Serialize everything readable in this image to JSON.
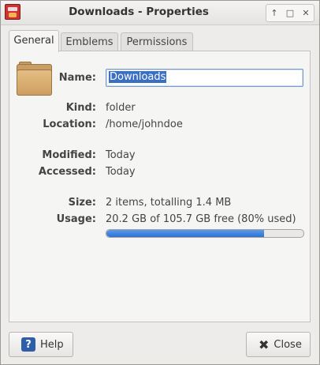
{
  "window": {
    "title": "Downloads - Properties",
    "buttons": {
      "up": "↑",
      "maximize": "□",
      "close": "✕"
    }
  },
  "tabs": [
    "General",
    "Emblems",
    "Permissions"
  ],
  "general": {
    "name_label": "Name:",
    "name_value": "Downloads",
    "kind_label": "Kind:",
    "kind_value": "folder",
    "location_label": "Location:",
    "location_value": "/home/johndoe",
    "modified_label": "Modified:",
    "modified_value": "Today",
    "accessed_label": "Accessed:",
    "accessed_value": "Today",
    "size_label": "Size:",
    "size_value": "2 items, totalling 1.4 MB",
    "usage_label": "Usage:",
    "usage_value": "20.2 GB of 105.7 GB free (80% used)",
    "usage_percent": 80
  },
  "footer": {
    "help_label": "Help",
    "close_label": "Close"
  },
  "colors": {
    "accent": "#3a6fc4",
    "bar": "#3b7fdc"
  }
}
